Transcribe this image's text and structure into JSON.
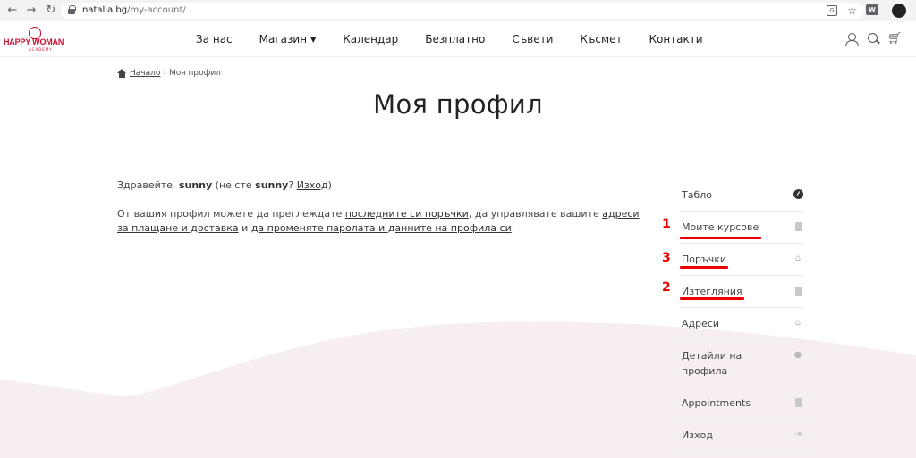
{
  "browser": {
    "url_domain": "natalia.bg",
    "url_path": "/my-account/",
    "ext_label": "W"
  },
  "site": {
    "logo_text": "HAPPY WOMAN",
    "logo_sub": "ACADEMY",
    "nav": [
      {
        "label": "За нас"
      },
      {
        "label": "Магазин",
        "has_dropdown": true
      },
      {
        "label": "Календар"
      },
      {
        "label": "Безплатно"
      },
      {
        "label": "Съвети"
      },
      {
        "label": "Късмет"
      },
      {
        "label": "Контакти"
      }
    ]
  },
  "breadcrumb": {
    "home": "Начало",
    "separator": "›",
    "current": "Моя профил"
  },
  "page_title": "Моя профил",
  "greeting": {
    "hello": "Здравейте, ",
    "user": "sunny",
    "not_user_prefix": " (не сте ",
    "not_user_suffix": "? ",
    "logout_link": "Изход",
    "close_paren": ")"
  },
  "intro": {
    "part1": "От вашия профил можете да преглеждате ",
    "link_orders": "последните си поръчки",
    "part2": ", да управлявате вашите ",
    "link_addresses": "адреси за плащане и доставка",
    "part3": " и ",
    "link_account": "да променяте паролата и данните на профила си",
    "part4": "."
  },
  "account_menu": [
    {
      "label": "Табло",
      "icon": "dashboard-icon"
    },
    {
      "label": "Моите курсове",
      "icon": "file-icon"
    },
    {
      "label": "Поръчки",
      "icon": "basket-icon"
    },
    {
      "label": "Изтегляния",
      "icon": "file-icon"
    },
    {
      "label": "Адреси",
      "icon": "home-icon"
    },
    {
      "label": "Детайли на профила",
      "icon": "user-icon"
    },
    {
      "label": "Appointments",
      "icon": "file-icon"
    },
    {
      "label": "Изход",
      "icon": "sign-out-icon"
    }
  ],
  "annotations": {
    "marker_1": "1",
    "marker_2": "2",
    "marker_3": "3",
    "color": "#e00000"
  },
  "colors": {
    "brand": "#c8102e",
    "wave": "#f7eef0"
  }
}
